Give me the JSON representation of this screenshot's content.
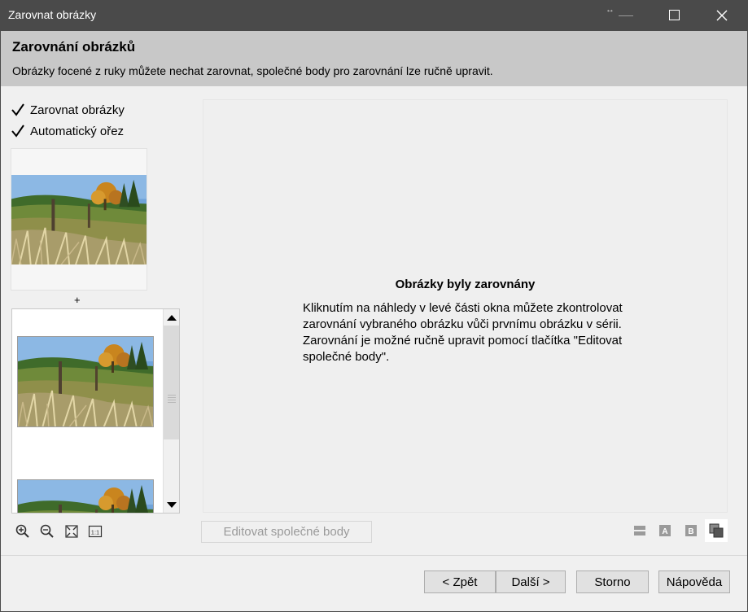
{
  "window": {
    "title": "Zarovnat obrázky"
  },
  "header": {
    "title": "Zarovnání obrázků",
    "subtitle": "Obrázky focené z ruky můžete nechat zarovnat, společné body pro zarovnání lze ručně upravit."
  },
  "options": {
    "align_label": "Zarovnat obrázky",
    "align_checked": true,
    "crop_label": "Automatický ořez",
    "crop_checked": true
  },
  "plus_label": "+",
  "zoom_tools": [
    "zoom-in-icon",
    "zoom-out-icon",
    "fit-to-window-icon",
    "actual-size-icon"
  ],
  "actual_size_label": "1:1",
  "message": {
    "title": "Obrázky byly zarovnány",
    "body": "Kliknutím na náhledy v levé části okna můžete zkontrolovat zarovnání vybraného obrázku vůči prvnímu obrázku v sérii. Zarovnání je možné ručně upravit pomocí tlačítka \"Editovat společné body\"."
  },
  "edit_button": "Editovat společné body",
  "view_modes": {
    "a_label": "A",
    "b_label": "B"
  },
  "footer": {
    "back": "< Zpět",
    "next": "Další >",
    "cancel": "Storno",
    "help": "Nápověda"
  },
  "colors": {
    "titlebar": "#4a4a4a",
    "header": "#c8c8c8",
    "background": "#f0f0f0"
  }
}
